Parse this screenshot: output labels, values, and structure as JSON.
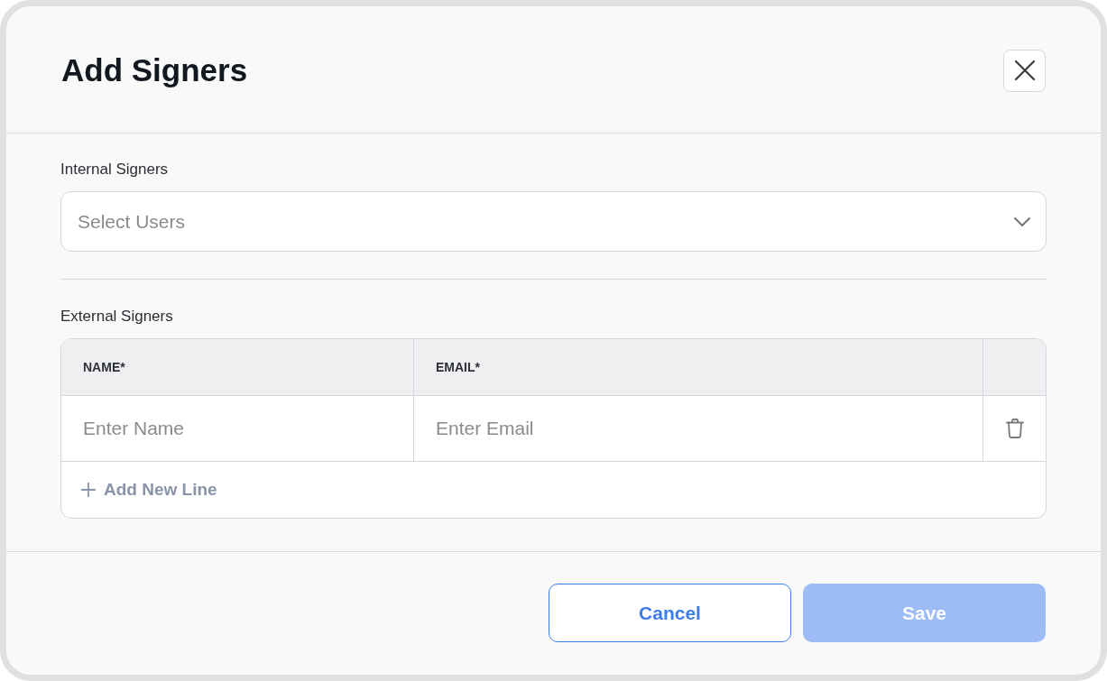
{
  "dialog": {
    "title": "Add Signers"
  },
  "internal_signers": {
    "label": "Internal Signers",
    "select": {
      "placeholder": "Select Users"
    }
  },
  "external_signers": {
    "label": "External Signers",
    "table": {
      "columns": [
        "NAME*",
        "EMAIL*"
      ],
      "rows": [
        {
          "name": {
            "placeholder": "Enter Name"
          },
          "email": {
            "placeholder": "Enter Email"
          }
        }
      ]
    },
    "add_line": "Add New Line"
  },
  "buttons": [
    {
      "label": "Cancel",
      "kind": "secondary",
      "disabled": false
    },
    {
      "label": "Save",
      "kind": "primary",
      "disabled": true
    }
  ]
}
